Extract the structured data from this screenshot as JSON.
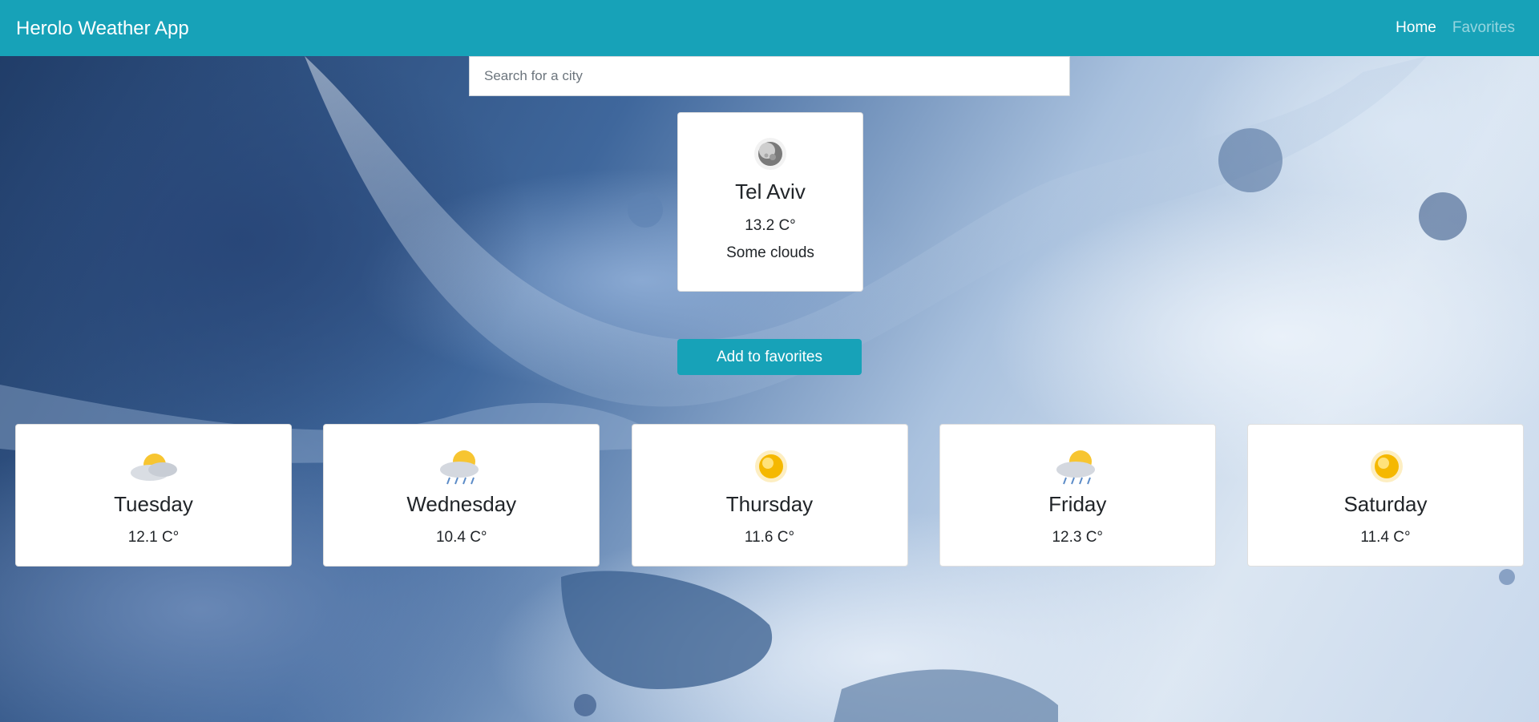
{
  "navbar": {
    "brand": "Herolo Weather App",
    "links": [
      {
        "label": "Home",
        "active": true
      },
      {
        "label": "Favorites",
        "active": false
      }
    ]
  },
  "search": {
    "placeholder": "Search for a city",
    "value": ""
  },
  "current": {
    "city": "Tel Aviv",
    "temperature": "13.2 C°",
    "condition": "Some clouds",
    "icon": "moon-icon"
  },
  "favorites_button": {
    "label": "Add to favorites"
  },
  "forecast": [
    {
      "day": "Tuesday",
      "temperature": "12.1 C°",
      "icon": "partly-sunny-icon"
    },
    {
      "day": "Wednesday",
      "temperature": "10.4 C°",
      "icon": "sun-rain-icon"
    },
    {
      "day": "Thursday",
      "temperature": "11.6 C°",
      "icon": "sun-icon"
    },
    {
      "day": "Friday",
      "temperature": "12.3 C°",
      "icon": "sun-rain-icon"
    },
    {
      "day": "Saturday",
      "temperature": "11.4 C°",
      "icon": "sun-icon"
    }
  ],
  "colors": {
    "accent": "#17a2b8",
    "card": "#ffffff",
    "text": "#212529"
  }
}
